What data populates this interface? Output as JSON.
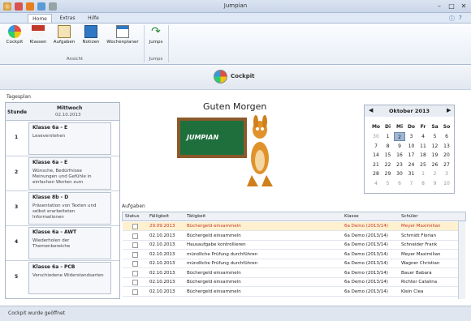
{
  "app": {
    "title": "Jumpian"
  },
  "colors": {
    "accent": "#2b63a8",
    "past_date": "#c0392b",
    "selected_row": "#fff0cf"
  },
  "ribbon": {
    "tabs": [
      "Home",
      "Extras",
      "Hilfe"
    ],
    "buttons": [
      {
        "label": "Cockpit",
        "icon": "cockpit-icon"
      },
      {
        "label": "Klassen",
        "icon": "house-icon"
      },
      {
        "label": "Aufgaben",
        "icon": "clipboard-icon"
      },
      {
        "label": "Notizen",
        "icon": "notebook-icon"
      },
      {
        "label": "Wochenplaner",
        "icon": "calendar-icon"
      },
      {
        "label": "Jumps",
        "icon": "jump-arrow-icon"
      }
    ],
    "groups": [
      "Ansicht",
      "Jumps"
    ]
  },
  "banner": {
    "title": "Cockpit"
  },
  "schedule": {
    "title": "Tagesplan",
    "col_stunde": "Stunde",
    "day": "Mittwoch",
    "date": "02.10.2013",
    "periods": [
      {
        "num": "1",
        "class": "Klasse 6a - E",
        "text": "Leseverstehen"
      },
      {
        "num": "2",
        "class": "Klasse 6a - E",
        "text": "Wünsche, Bedürfnisse Meinungen und Gefühle in einfachen Worten zum"
      },
      {
        "num": "3",
        "class": "Klasse 8b - D",
        "text": "Präsentation von Texten und selbst erarbeiteten Informationen"
      },
      {
        "num": "4",
        "class": "Klasse 6a - AWT",
        "text": "Wiederholen der Themenbereiche"
      },
      {
        "num": "5",
        "class": "Klasse 6a - PCB",
        "text": "Verschiedene Widerstandsarten"
      }
    ]
  },
  "greeting": "Guten Morgen",
  "logo_text": "JUMPIAN",
  "calendar": {
    "month": "Oktober 2013",
    "dow": [
      "Mo",
      "Di",
      "Mi",
      "Do",
      "Fr",
      "Sa",
      "So"
    ],
    "weeks": [
      [
        "30",
        "1",
        "2",
        "3",
        "4",
        "5",
        "6"
      ],
      [
        "7",
        "8",
        "9",
        "10",
        "11",
        "12",
        "13"
      ],
      [
        "14",
        "15",
        "16",
        "17",
        "18",
        "19",
        "20"
      ],
      [
        "21",
        "22",
        "23",
        "24",
        "25",
        "26",
        "27"
      ],
      [
        "28",
        "29",
        "30",
        "31",
        "1",
        "2",
        "3"
      ],
      [
        "4",
        "5",
        "6",
        "7",
        "8",
        "9",
        "10"
      ]
    ]
  },
  "tasks": {
    "title": "Aufgaben",
    "columns": [
      "Status",
      "Fälligkeit",
      "Tätigkeit",
      "Klasse",
      "Schüler"
    ],
    "rows": [
      [
        "29.09.2013",
        "Büchergeld einsammeln",
        "6a Demo (2013/14)",
        "Meyer Maximilian"
      ],
      [
        "02.10.2013",
        "Büchergeld einsammeln",
        "6a Demo (2013/14)",
        "Schmidt Florian"
      ],
      [
        "02.10.2013",
        "Hausaufgabe kontrollieren",
        "6a Demo (2013/14)",
        "Schneider Frank"
      ],
      [
        "02.10.2013",
        "mündliche Prüfung durchführen",
        "6a Demo (2013/14)",
        "Meyer Maximilian"
      ],
      [
        "02.10.2013",
        "mündliche Prüfung durchführen",
        "6a Demo (2013/14)",
        "Wagner Christian"
      ],
      [
        "02.10.2013",
        "Büchergeld einsammeln",
        "6a Demo (2013/14)",
        "Bauer Babara"
      ],
      [
        "02.10.2013",
        "Büchergeld einsammeln",
        "6a Demo (2013/14)",
        "Richter Catalina"
      ],
      [
        "02.10.2013",
        "Büchergeld einsammeln",
        "6a Demo (2013/14)",
        "Klein Clea"
      ]
    ]
  },
  "status": "Cockpit wurde geöffnet"
}
